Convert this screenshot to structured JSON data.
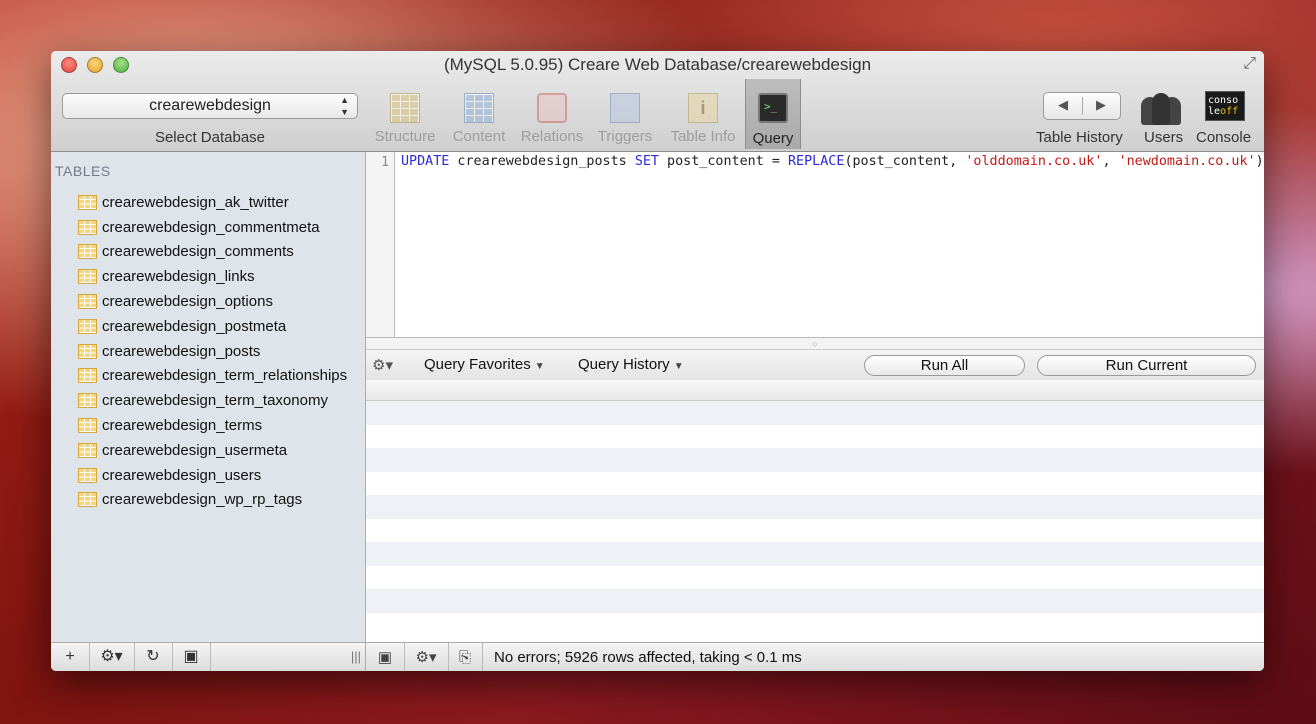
{
  "window": {
    "title": "(MySQL 5.0.95) Creare Web Database/crearewebdesign"
  },
  "toolbar": {
    "database_selected": "crearewebdesign",
    "select_database_label": "Select Database",
    "buttons": [
      {
        "label": "Structure",
        "icon": "structure-icon"
      },
      {
        "label": "Content",
        "icon": "content-icon"
      },
      {
        "label": "Relations",
        "icon": "relations-icon"
      },
      {
        "label": "Triggers",
        "icon": "triggers-icon"
      },
      {
        "label": "Table Info",
        "icon": "table-info-icon"
      },
      {
        "label": "Query",
        "icon": "query-icon"
      }
    ],
    "active": "Query",
    "table_history_label": "Table History",
    "users_label": "Users",
    "console_label": "Console",
    "console_icon_text": [
      "conso",
      "le",
      "off"
    ]
  },
  "sidebar": {
    "heading": "TABLES",
    "tables": [
      "crearewebdesign_ak_twitter",
      "crearewebdesign_commentmeta",
      "crearewebdesign_comments",
      "crearewebdesign_links",
      "crearewebdesign_options",
      "crearewebdesign_postmeta",
      "crearewebdesign_posts",
      "crearewebdesign_term_relationships",
      "crearewebdesign_term_taxonomy",
      "crearewebdesign_terms",
      "crearewebdesign_usermeta",
      "crearewebdesign_users",
      "crearewebdesign_wp_rp_tags"
    ]
  },
  "editor": {
    "line_number": "1",
    "query_parts": {
      "kw1": "UPDATE",
      "t1": " crearewebdesign_posts ",
      "kw2": "SET",
      "t2": " post_content = ",
      "kw3": "REPLACE",
      "t3": "(post_content, ",
      "s1": "'olddomain.co.uk'",
      "t4": ", ",
      "s2": "'newdomain.co.uk'",
      "t5": ");"
    }
  },
  "query_bar": {
    "favorites_label": "Query Favorites",
    "history_label": "Query History",
    "run_all_label": "Run All",
    "run_current_label": "Run Current"
  },
  "status": {
    "message": "No errors; 5926 rows affected, taking < 0.1 ms"
  },
  "colors": {
    "keyword": "#2b2bd6",
    "string": "#c41a16",
    "sidebar_bg": "#dfe4ea"
  }
}
